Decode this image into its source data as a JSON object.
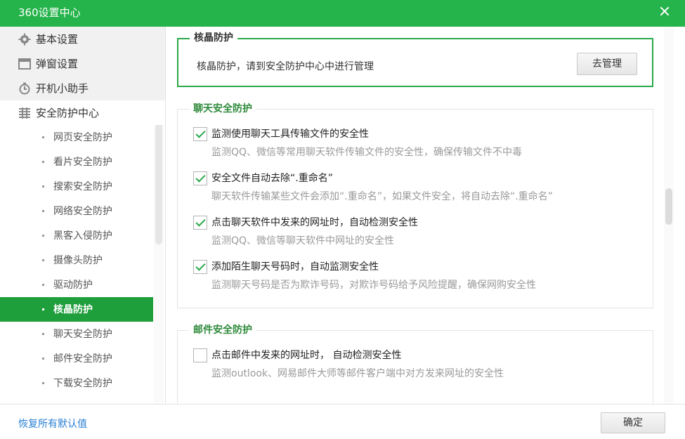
{
  "window": {
    "title": "360设置中心"
  },
  "sidebar": {
    "categories": [
      {
        "label": "基本设置",
        "icon": "gear-icon"
      },
      {
        "label": "弹窗设置",
        "icon": "window-icon"
      },
      {
        "label": "开机小助手",
        "icon": "timer-icon"
      },
      {
        "label": "安全防护中心",
        "icon": "shield-list-icon"
      }
    ],
    "items": [
      {
        "label": "网页安全防护"
      },
      {
        "label": "看片安全防护"
      },
      {
        "label": "搜索安全防护"
      },
      {
        "label": "网络安全防护"
      },
      {
        "label": "黑客入侵防护"
      },
      {
        "label": "摄像头防护"
      },
      {
        "label": "驱动防护"
      },
      {
        "label": "核晶防护",
        "active": true
      },
      {
        "label": "聊天安全防护"
      },
      {
        "label": "邮件安全防护"
      },
      {
        "label": "下载安全防护"
      }
    ]
  },
  "core": {
    "title": "核晶防护",
    "desc": "核晶防护，请到安全防护中心中进行管理",
    "button": "去管理"
  },
  "chat": {
    "title": "聊天安全防护",
    "options": [
      {
        "label": "监测使用聊天工具传输文件的安全性",
        "desc": "监测QQ、微信等常用聊天软件传输文件的安全性，确保传输文件不中毒",
        "checked": true
      },
      {
        "label": "安全文件自动去除“.重命名”",
        "desc": "聊天软件传输某些文件会添加“.重命名”，如果文件安全，将自动去除“.重命名”",
        "checked": true
      },
      {
        "label": "点击聊天软件中发来的网址时，自动检测安全性",
        "desc": "监测QQ、微信等聊天软件中网址的安全性",
        "checked": true
      },
      {
        "label": "添加陌生聊天号码时，自动监测安全性",
        "desc": "监测聊天号码是否为欺诈号码，对欺诈号码给予风险提醒，确保网购安全性",
        "checked": true
      }
    ]
  },
  "mail": {
    "title": "邮件安全防护",
    "options": [
      {
        "label": "点击邮件中发来的网址时，  自动检测安全性",
        "desc": "监测outlook、网易邮件大师等邮件客户端中对方发来网址的安全性",
        "checked": false
      }
    ]
  },
  "footer": {
    "restore": "恢复所有默认值",
    "ok": "确定"
  },
  "colors": {
    "accent": "#25b34b",
    "active_bg": "#1f9e3c",
    "link": "#2a7fd3"
  }
}
